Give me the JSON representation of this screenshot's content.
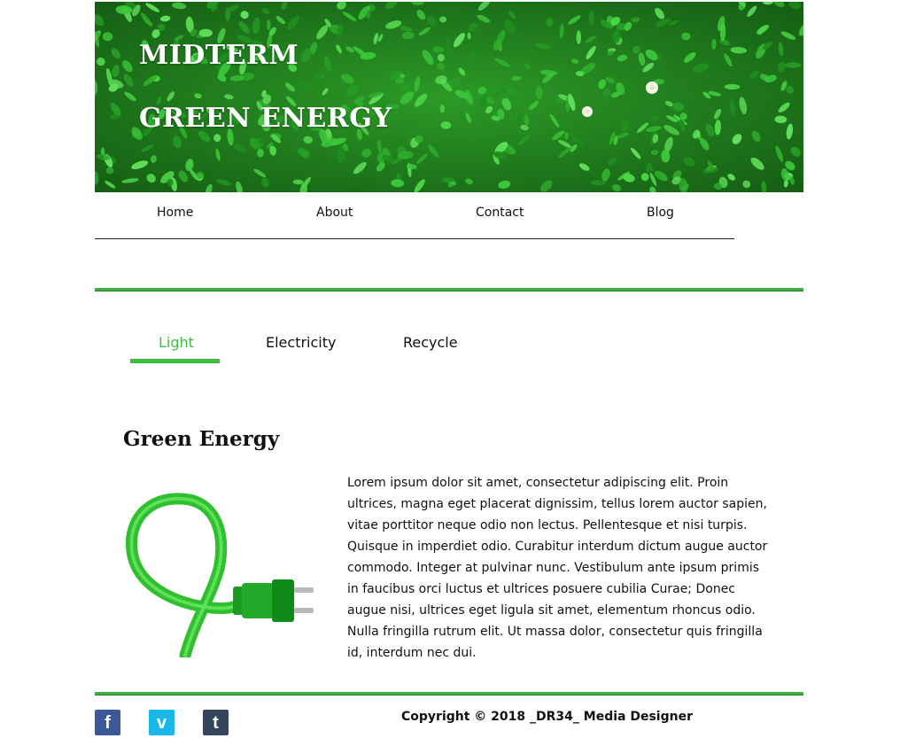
{
  "header": {
    "title_line1": "MIDTERM",
    "title_line2": "GREEN ENERGY"
  },
  "nav": {
    "items": [
      {
        "label": "Home"
      },
      {
        "label": "About"
      },
      {
        "label": "Contact"
      },
      {
        "label": "Blog"
      }
    ]
  },
  "tabs": {
    "items": [
      {
        "label": "Light",
        "active": true
      },
      {
        "label": "Electricity",
        "active": false
      },
      {
        "label": "Recycle",
        "active": false
      }
    ]
  },
  "content": {
    "heading": "Green Energy",
    "image_icon": "green-grass-power-plug",
    "paragraph": "Lorem ipsum dolor sit amet, consectetur adipiscing elit. Proin ultrices, magna eget placerat dignissim, tellus lorem auctor sapien, vitae porttitor neque odio non lectus. Pellentesque et nisi turpis. Quisque in imperdiet odio. Curabitur interdum dictum augue auctor commodo. Integer at pulvinar nunc. Vestibulum ante ipsum primis in faucibus orci luctus et ultrices posuere cubilia Curae; Donec augue nisi, ultrices eget ligula sit amet, elementum rhoncus odio. Nulla fringilla rutrum elit. Ut massa dolor, consectetur quis fringilla id, interdum nec dui."
  },
  "footer": {
    "social": [
      {
        "icon": "facebook-icon",
        "glyph": "f",
        "color": "#3b5998"
      },
      {
        "icon": "vimeo-icon",
        "glyph": "v",
        "color": "#1ab7ea"
      },
      {
        "icon": "tumblr-icon",
        "glyph": "t",
        "color": "#35465c"
      }
    ],
    "copyright": "Copyright © 2018 _DR34_ Media Designer"
  },
  "colors": {
    "accent": "#3cbf3c",
    "banner_green": "#1f7d1c"
  }
}
